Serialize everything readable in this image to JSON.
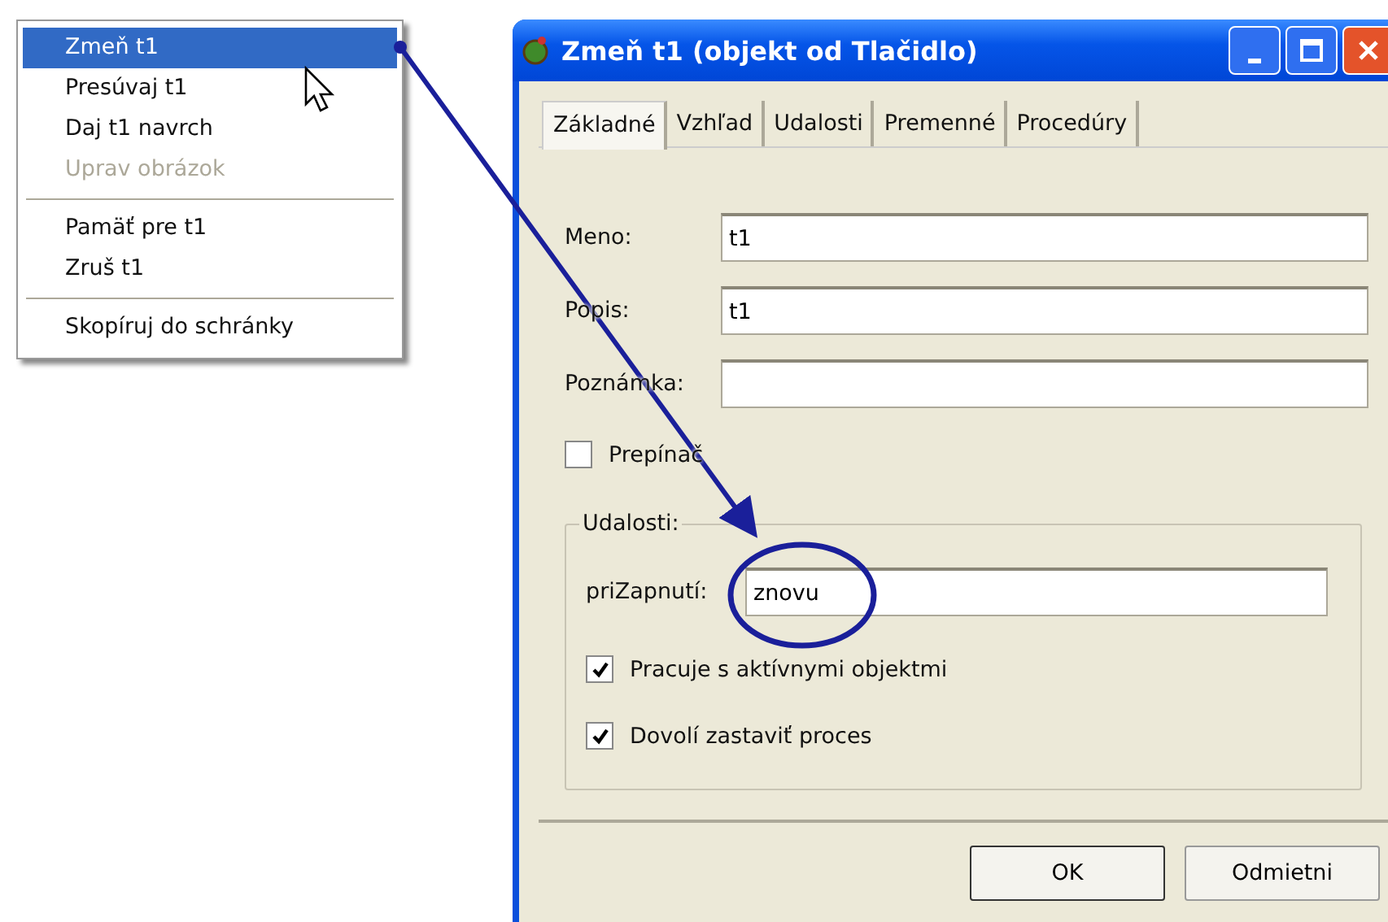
{
  "context_menu": {
    "items": [
      {
        "kind": "item",
        "label": "Zmeň t1",
        "selected": true,
        "disabled": false
      },
      {
        "kind": "item",
        "label": "Presúvaj t1",
        "selected": false,
        "disabled": false
      },
      {
        "kind": "item",
        "label": "Daj t1 navrch",
        "selected": false,
        "disabled": false
      },
      {
        "kind": "item",
        "label": "Uprav obrázok",
        "selected": false,
        "disabled": true
      },
      {
        "kind": "separator"
      },
      {
        "kind": "item",
        "label": "Pamäť pre t1",
        "selected": false,
        "disabled": false
      },
      {
        "kind": "item",
        "label": "Zruš t1",
        "selected": false,
        "disabled": false
      },
      {
        "kind": "separator"
      },
      {
        "kind": "item",
        "label": "Skopíruj do schránky",
        "selected": false,
        "disabled": false
      }
    ]
  },
  "window": {
    "title": "Zmeň t1 (objekt od Tlačidlo)",
    "tabs": [
      {
        "label": "Základné",
        "selected": true
      },
      {
        "label": "Vzhľad",
        "selected": false
      },
      {
        "label": "Udalosti",
        "selected": false
      },
      {
        "label": "Premenné",
        "selected": false
      },
      {
        "label": "Procedúry",
        "selected": false
      }
    ],
    "fields": [
      {
        "label": "Meno:",
        "value": "t1"
      },
      {
        "label": "Popis:",
        "value": "t1"
      },
      {
        "label": "Poznámka:"
      }
    ],
    "toggle": {
      "label": "Prepínač",
      "checked": false
    },
    "events_group": {
      "title": "Udalosti:",
      "field": {
        "label": "priZapnutí:",
        "value": "znovu"
      },
      "options": [
        {
          "label": "Pracuje s aktívnymi objektmi",
          "checked": true
        },
        {
          "label": "Dovolí zastaviť proces",
          "checked": true
        }
      ]
    },
    "buttons": [
      {
        "label": "OK"
      },
      {
        "label": "Odmietni"
      }
    ]
  }
}
